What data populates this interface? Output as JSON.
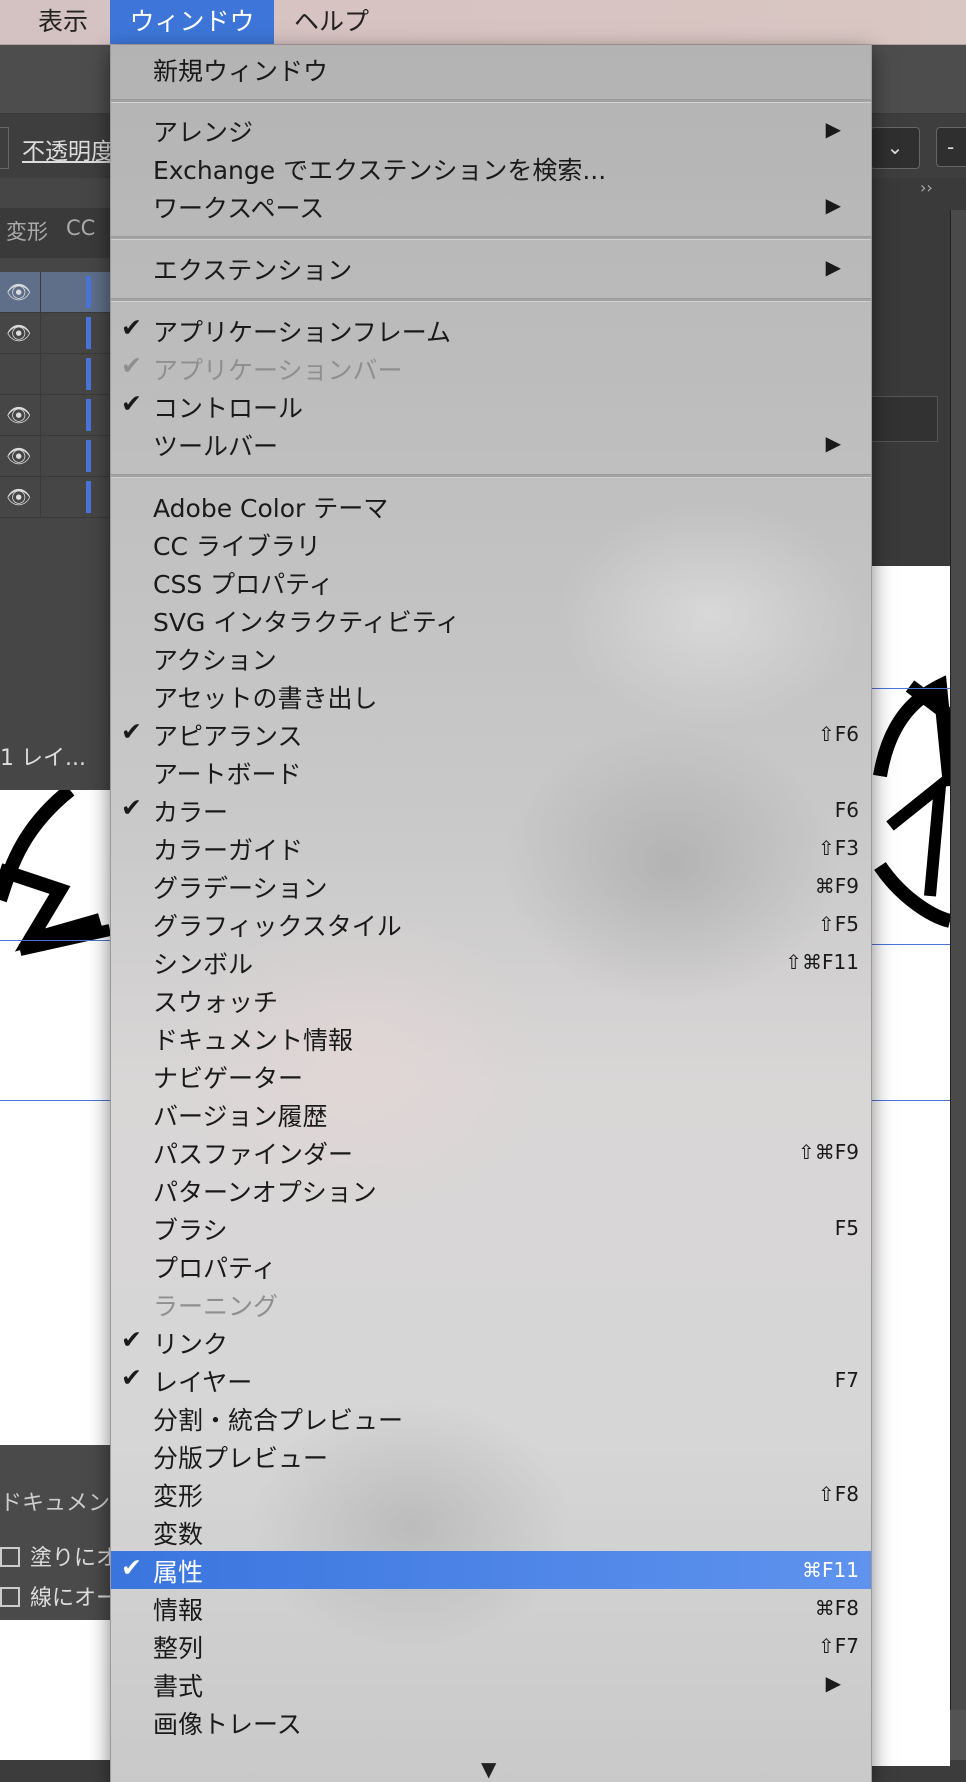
{
  "menubar": {
    "items": [
      {
        "label": "表示"
      },
      {
        "label": "ウィンドウ"
      },
      {
        "label": "ヘルプ"
      }
    ]
  },
  "background": {
    "opacity_label": "不透明度",
    "panel_tabs": [
      "変形",
      "CC"
    ],
    "layer_count": "1 レイ...",
    "bottom_panel_title": "ドキュメン",
    "checkbox_fill": "塗りにオ",
    "checkbox_stroke": "線にオー",
    "right_select": "⌄",
    "right_field": "-"
  },
  "menu": {
    "items": [
      {
        "label": "新規ウィンドウ"
      },
      {
        "label": "アレンジ",
        "submenu": true
      },
      {
        "label": "Exchange でエクステンションを検索..."
      },
      {
        "label": "ワークスペース",
        "submenu": true
      },
      {
        "label": "エクステンション",
        "submenu": true
      },
      {
        "label": "アプリケーションフレーム",
        "checked": true
      },
      {
        "label": "アプリケーションバー",
        "checked": true,
        "disabled": true
      },
      {
        "label": "コントロール",
        "checked": true
      },
      {
        "label": "ツールバー",
        "submenu": true
      },
      {
        "label": "Adobe Color テーマ"
      },
      {
        "label": "CC ライブラリ"
      },
      {
        "label": "CSS プロパティ"
      },
      {
        "label": "SVG インタラクティビティ"
      },
      {
        "label": "アクション"
      },
      {
        "label": "アセットの書き出し"
      },
      {
        "label": "アピアランス",
        "checked": true,
        "shortcut": "⇧F6"
      },
      {
        "label": "アートボード"
      },
      {
        "label": "カラー",
        "checked": true,
        "shortcut": "F6"
      },
      {
        "label": "カラーガイド",
        "shortcut": "⇧F3"
      },
      {
        "label": "グラデーション",
        "shortcut": "⌘F9"
      },
      {
        "label": "グラフィックスタイル",
        "shortcut": "⇧F5"
      },
      {
        "label": "シンボル",
        "shortcut": "⇧⌘F11"
      },
      {
        "label": "スウォッチ"
      },
      {
        "label": "ドキュメント情報"
      },
      {
        "label": "ナビゲーター"
      },
      {
        "label": "バージョン履歴"
      },
      {
        "label": "パスファインダー",
        "shortcut": "⇧⌘F9"
      },
      {
        "label": "パターンオプション"
      },
      {
        "label": "ブラシ",
        "shortcut": "F5"
      },
      {
        "label": "プロパティ"
      },
      {
        "label": "ラーニング",
        "disabled": true
      },
      {
        "label": "リンク",
        "checked": true
      },
      {
        "label": "レイヤー",
        "checked": true,
        "shortcut": "F7"
      },
      {
        "label": "分割・統合プレビュー"
      },
      {
        "label": "分版プレビュー"
      },
      {
        "label": "変形",
        "shortcut": "⇧F8"
      },
      {
        "label": "変数"
      },
      {
        "label": "属性",
        "checked": true,
        "selected": true,
        "shortcut": "⌘F11"
      },
      {
        "label": "情報",
        "shortcut": "⌘F8"
      },
      {
        "label": "整列",
        "shortcut": "⇧F7"
      },
      {
        "label": "書式",
        "submenu": true
      },
      {
        "label": "画像トレース"
      }
    ],
    "check_glyph": "✔",
    "submenu_glyph": "▶",
    "scroll_glyph": "▼"
  },
  "colors": {
    "menubar_active": "#3d76d8",
    "selected_item": "#3a75de",
    "guide": "#4a74d8"
  }
}
